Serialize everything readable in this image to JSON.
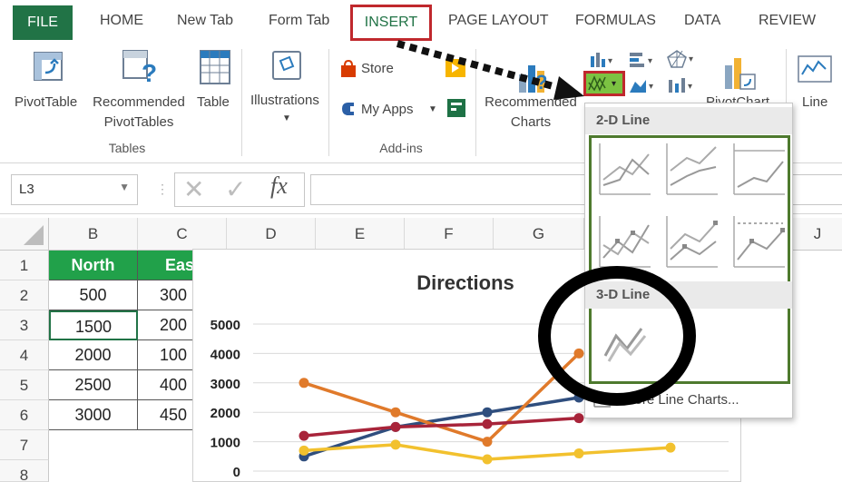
{
  "ribbon_tabs": {
    "file": "FILE",
    "home": "HOME",
    "new_tab": "New Tab",
    "form_tab": "Form Tab",
    "insert": "INSERT",
    "page_layout": "PAGE LAYOUT",
    "formulas": "FORMULAS",
    "data": "DATA",
    "review": "REVIEW"
  },
  "ribbon": {
    "pivot_table": "PivotTable",
    "recommended_pivot_1": "Recommended",
    "recommended_pivot_2": "PivotTables",
    "table": "Table",
    "tables_group": "Tables",
    "illustrations": "Illustrations",
    "store": "Store",
    "my_apps": "My Apps",
    "addins_group": "Add-ins",
    "recommended_charts_1": "Recommended",
    "recommended_charts_2": "Charts",
    "pivot_chart": "PivotChart",
    "line": "Line"
  },
  "formula_bar": {
    "name_box": "L3",
    "fx": "fx",
    "value": ""
  },
  "grid": {
    "columns": [
      "B",
      "C",
      "D",
      "E",
      "F",
      "G",
      "J"
    ],
    "rows": [
      "1",
      "2",
      "3",
      "4",
      "5",
      "6",
      "7",
      "8"
    ],
    "header_row": [
      "North",
      "Eas"
    ],
    "data_rows": [
      [
        "500",
        "300"
      ],
      [
        "1500",
        "200"
      ],
      [
        "2000",
        "100"
      ],
      [
        "2500",
        "400"
      ],
      [
        "3000",
        "450"
      ]
    ]
  },
  "dropdown": {
    "section_2d": "2-D Line",
    "section_3d": "3-D Line",
    "more": "More Line Charts..."
  },
  "chart_data": {
    "type": "line",
    "title": "Directions",
    "ylim": [
      0,
      5000
    ],
    "yticks": [
      "0",
      "1000",
      "2000",
      "3000",
      "4000",
      "5000"
    ],
    "grid": true,
    "series": [
      {
        "color": "#2f4e7e",
        "values": [
          500,
          1500,
          2000,
          2500
        ]
      },
      {
        "color": "#e07a2b",
        "values": [
          3000,
          2000,
          1000,
          4000
        ]
      },
      {
        "color": "#a8243a",
        "values": [
          1200,
          1500,
          1600,
          1800
        ]
      },
      {
        "color": "#f2c12e",
        "values": [
          700,
          900,
          400,
          600,
          800
        ]
      }
    ]
  },
  "colors": {
    "excel_green": "#217346",
    "header_green": "#21a14a",
    "annotation_red": "#c0282d",
    "dropdown_border_green": "#4e7a2e"
  }
}
